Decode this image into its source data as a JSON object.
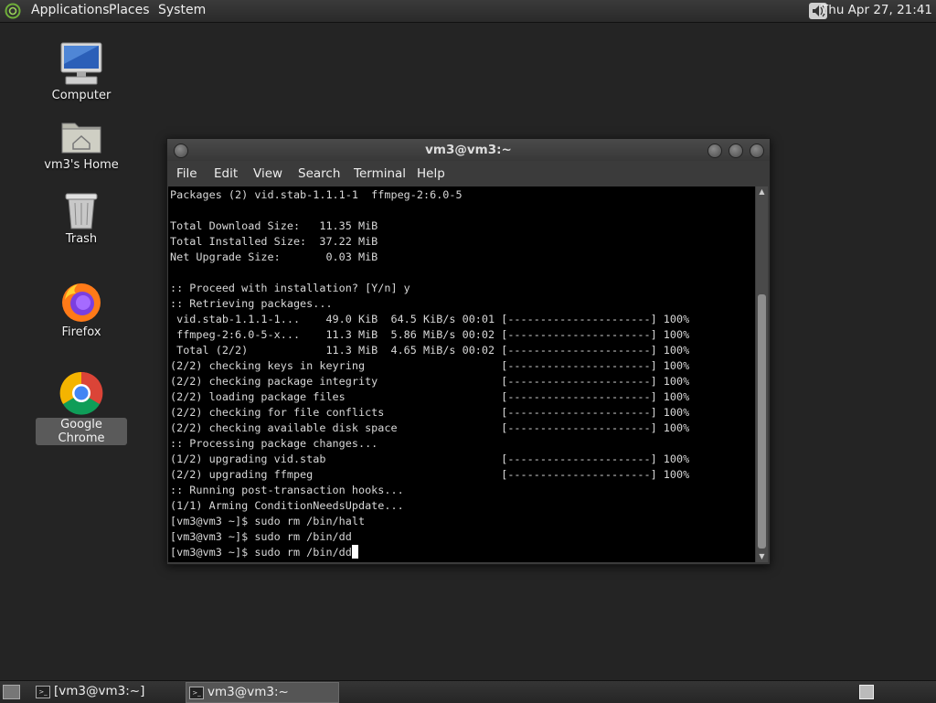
{
  "top_panel": {
    "menus": [
      "Applications",
      "Places",
      "System"
    ],
    "clock": "Thu Apr 27, 21:41",
    "icons": {
      "logo": "gnome-foot-icon",
      "volume": "volume-icon"
    }
  },
  "desktop": {
    "icons": [
      {
        "label": "Computer",
        "icon": "computer-icon"
      },
      {
        "label": "vm3's Home",
        "icon": "home-folder-icon"
      },
      {
        "label": "Trash",
        "icon": "trash-icon"
      },
      {
        "label": "Firefox",
        "icon": "firefox-icon"
      },
      {
        "label": "Google Chrome",
        "icon": "chrome-icon"
      }
    ]
  },
  "terminal": {
    "title": "vm3@vm3:~",
    "menu": [
      "File",
      "Edit",
      "View",
      "Search",
      "Terminal",
      "Help"
    ],
    "lines": [
      "Packages (2) vid.stab-1.1.1-1  ffmpeg-2:6.0-5",
      "",
      "Total Download Size:   11.35 MiB",
      "Total Installed Size:  37.22 MiB",
      "Net Upgrade Size:       0.03 MiB",
      "",
      ":: Proceed with installation? [Y/n] y",
      ":: Retrieving packages...",
      " vid.stab-1.1.1-1...    49.0 KiB  64.5 KiB/s 00:01 [----------------------] 100%",
      " ffmpeg-2:6.0-5-x...    11.3 MiB  5.86 MiB/s 00:02 [----------------------] 100%",
      " Total (2/2)            11.3 MiB  4.65 MiB/s 00:02 [----------------------] 100%",
      "(2/2) checking keys in keyring                     [----------------------] 100%",
      "(2/2) checking package integrity                   [----------------------] 100%",
      "(2/2) loading package files                        [----------------------] 100%",
      "(2/2) checking for file conflicts                  [----------------------] 100%",
      "(2/2) checking available disk space                [----------------------] 100%",
      ":: Processing package changes...",
      "(1/2) upgrading vid.stab                           [----------------------] 100%",
      "(2/2) upgrading ffmpeg                             [----------------------] 100%",
      ":: Running post-transaction hooks...",
      "(1/1) Arming ConditionNeedsUpdate...",
      "[vm3@vm3 ~]$ sudo rm /bin/halt",
      "[vm3@vm3 ~]$ sudo rm /bin/dd"
    ],
    "prompt": "[vm3@vm3 ~]$ ",
    "current_input": "sudo rm /bin/dd"
  },
  "taskbar": {
    "tasks": [
      {
        "label": "[vm3@vm3:~]",
        "active": false
      },
      {
        "label": "vm3@vm3:~",
        "active": true
      }
    ]
  }
}
